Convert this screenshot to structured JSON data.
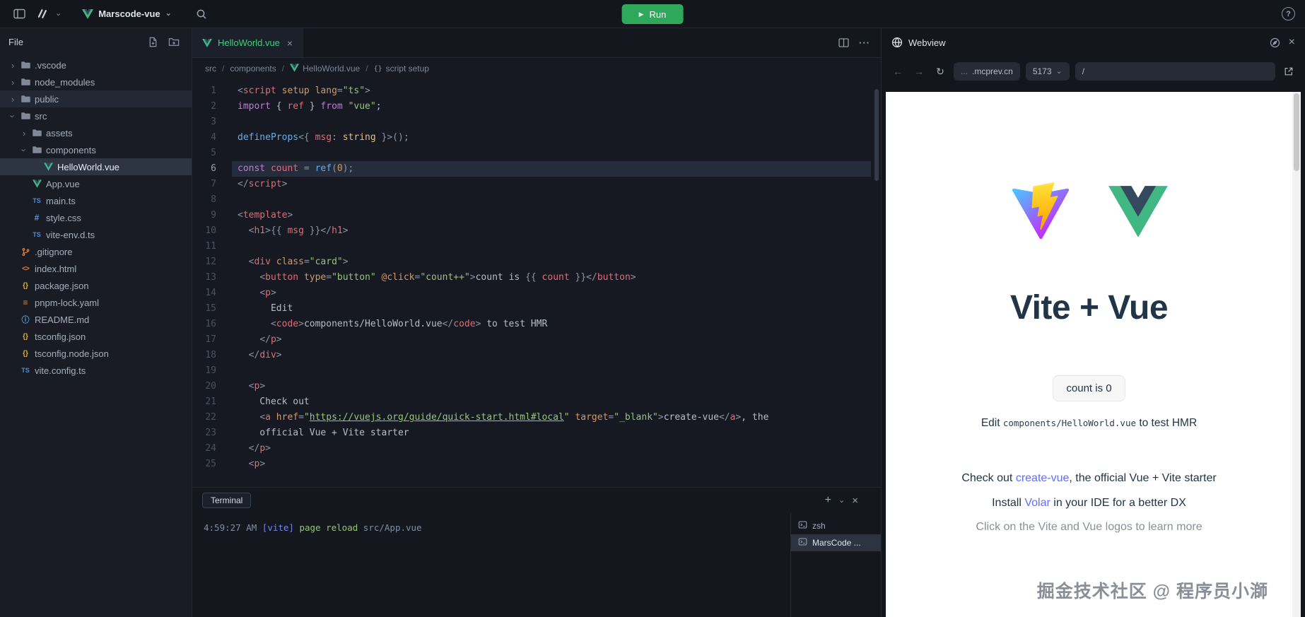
{
  "icons": {
    "chevron_down": "⌄",
    "chevron_right": "›",
    "close": "×",
    "plus": "+",
    "more": "···",
    "play": "▶",
    "help": "?",
    "back": "←",
    "forward": "→",
    "refresh": "↻",
    "crumb_sep": "/",
    "braces": "{}"
  },
  "topbar": {
    "project_name": "Marscode-vue",
    "run_label": "Run"
  },
  "sidebar": {
    "title": "File",
    "tree": [
      {
        "label": ".vscode",
        "type": "folder",
        "level": 0,
        "expanded": false
      },
      {
        "label": "node_modules",
        "type": "folder",
        "level": 0,
        "expanded": false
      },
      {
        "label": "public",
        "type": "folder",
        "level": 0,
        "expanded": false,
        "state": "hover"
      },
      {
        "label": "src",
        "type": "folder",
        "level": 0,
        "expanded": true
      },
      {
        "label": "assets",
        "type": "folder",
        "level": 1,
        "expanded": false
      },
      {
        "label": "components",
        "type": "folder",
        "level": 1,
        "expanded": true
      },
      {
        "label": "HelloWorld.vue",
        "type": "vue",
        "level": 2,
        "state": "selected"
      },
      {
        "label": "App.vue",
        "type": "vue",
        "level": 1
      },
      {
        "label": "main.ts",
        "type": "ts",
        "level": 1
      },
      {
        "label": "style.css",
        "type": "css",
        "level": 1
      },
      {
        "label": "vite-env.d.ts",
        "type": "ts",
        "level": 1
      },
      {
        "label": ".gitignore",
        "type": "git",
        "level": 0
      },
      {
        "label": "index.html",
        "type": "html",
        "level": 0
      },
      {
        "label": "package.json",
        "type": "json",
        "level": 0
      },
      {
        "label": "pnpm-lock.yaml",
        "type": "yaml",
        "level": 0
      },
      {
        "label": "README.md",
        "type": "md",
        "level": 0
      },
      {
        "label": "tsconfig.json",
        "type": "json",
        "level": 0
      },
      {
        "label": "tsconfig.node.json",
        "type": "json",
        "level": 0
      },
      {
        "label": "vite.config.ts",
        "type": "ts",
        "level": 0
      }
    ]
  },
  "editor": {
    "tab_label": "HelloWorld.vue",
    "breadcrumb": [
      {
        "label": "src"
      },
      {
        "label": "components"
      },
      {
        "label": "HelloWorld.vue",
        "icon": "vue"
      },
      {
        "label": "script setup",
        "icon": "braces"
      }
    ],
    "active_line": 6,
    "lines": [
      [
        [
          "pu",
          "<"
        ],
        [
          "tg",
          "script"
        ],
        [
          "pl",
          " "
        ],
        [
          "at",
          "setup"
        ],
        [
          "pl",
          " "
        ],
        [
          "at",
          "lang"
        ],
        [
          "pu",
          "="
        ],
        [
          "st",
          "\"ts\""
        ],
        [
          "pu",
          ">"
        ]
      ],
      [
        [
          "kw",
          "import"
        ],
        [
          "pl",
          " { "
        ],
        [
          "vr",
          "ref"
        ],
        [
          "pl",
          " } "
        ],
        [
          "kw",
          "from"
        ],
        [
          "pl",
          " "
        ],
        [
          "st",
          "\"vue\""
        ],
        [
          "pl",
          ";"
        ]
      ],
      [],
      [
        [
          "fn",
          "defineProps"
        ],
        [
          "pu",
          "<{ "
        ],
        [
          "vr",
          "msg"
        ],
        [
          "pu",
          ": "
        ],
        [
          "ty",
          "string"
        ],
        [
          "pu",
          " }>();"
        ]
      ],
      [],
      [
        [
          "kw",
          "const"
        ],
        [
          "pl",
          " "
        ],
        [
          "vr",
          "count"
        ],
        [
          "pu",
          " = "
        ],
        [
          "fn",
          "ref"
        ],
        [
          "pu",
          "("
        ],
        [
          "nu",
          "0"
        ],
        [
          "pu",
          ");"
        ]
      ],
      [
        [
          "pu",
          "</"
        ],
        [
          "tg",
          "script"
        ],
        [
          "pu",
          ">"
        ]
      ],
      [],
      [
        [
          "pu",
          "<"
        ],
        [
          "tg",
          "template"
        ],
        [
          "pu",
          ">"
        ]
      ],
      [
        [
          "pl",
          "  "
        ],
        [
          "pu",
          "<"
        ],
        [
          "tg",
          "h1"
        ],
        [
          "pu",
          ">"
        ],
        [
          "pu",
          "{{ "
        ],
        [
          "vr",
          "msg"
        ],
        [
          "pu",
          " }}"
        ],
        [
          "pu",
          "</"
        ],
        [
          "tg",
          "h1"
        ],
        [
          "pu",
          ">"
        ]
      ],
      [],
      [
        [
          "pl",
          "  "
        ],
        [
          "pu",
          "<"
        ],
        [
          "tg",
          "div"
        ],
        [
          "pl",
          " "
        ],
        [
          "at",
          "class"
        ],
        [
          "pu",
          "="
        ],
        [
          "st",
          "\"card\""
        ],
        [
          "pu",
          ">"
        ]
      ],
      [
        [
          "pl",
          "    "
        ],
        [
          "pu",
          "<"
        ],
        [
          "tg",
          "button"
        ],
        [
          "pl",
          " "
        ],
        [
          "at",
          "type"
        ],
        [
          "pu",
          "="
        ],
        [
          "st",
          "\"button\""
        ],
        [
          "pl",
          " "
        ],
        [
          "at",
          "@click"
        ],
        [
          "pu",
          "="
        ],
        [
          "st",
          "\"count++\""
        ],
        [
          "pu",
          ">"
        ],
        [
          "pl",
          "count is "
        ],
        [
          "pu",
          "{{ "
        ],
        [
          "vr",
          "count"
        ],
        [
          "pu",
          " }}"
        ],
        [
          "pu",
          "</"
        ],
        [
          "tg",
          "button"
        ],
        [
          "pu",
          ">"
        ]
      ],
      [
        [
          "pl",
          "    "
        ],
        [
          "pu",
          "<"
        ],
        [
          "tg",
          "p"
        ],
        [
          "pu",
          ">"
        ]
      ],
      [
        [
          "pl",
          "      Edit"
        ]
      ],
      [
        [
          "pl",
          "      "
        ],
        [
          "pu",
          "<"
        ],
        [
          "tg",
          "code"
        ],
        [
          "pu",
          ">"
        ],
        [
          "pl",
          "components/HelloWorld.vue"
        ],
        [
          "pu",
          "</"
        ],
        [
          "tg",
          "code"
        ],
        [
          "pu",
          ">"
        ],
        [
          "pl",
          " to test HMR"
        ]
      ],
      [
        [
          "pl",
          "    "
        ],
        [
          "pu",
          "</"
        ],
        [
          "tg",
          "p"
        ],
        [
          "pu",
          ">"
        ]
      ],
      [
        [
          "pl",
          "  "
        ],
        [
          "pu",
          "</"
        ],
        [
          "tg",
          "div"
        ],
        [
          "pu",
          ">"
        ]
      ],
      [],
      [
        [
          "pl",
          "  "
        ],
        [
          "pu",
          "<"
        ],
        [
          "tg",
          "p"
        ],
        [
          "pu",
          ">"
        ]
      ],
      [
        [
          "pl",
          "    Check out"
        ]
      ],
      [
        [
          "pl",
          "    "
        ],
        [
          "pu",
          "<"
        ],
        [
          "tg",
          "a"
        ],
        [
          "pl",
          " "
        ],
        [
          "at",
          "href"
        ],
        [
          "pu",
          "="
        ],
        [
          "st",
          "\""
        ],
        [
          "lk",
          "https://vuejs.org/guide/quick-start.html#local"
        ],
        [
          "st",
          "\""
        ],
        [
          "pl",
          " "
        ],
        [
          "at",
          "target"
        ],
        [
          "pu",
          "="
        ],
        [
          "st",
          "\"_blank\""
        ],
        [
          "pu",
          ">"
        ],
        [
          "pl",
          "create-vue"
        ],
        [
          "pu",
          "</"
        ],
        [
          "tg",
          "a"
        ],
        [
          "pu",
          ">"
        ],
        [
          "pl",
          ", the"
        ]
      ],
      [
        [
          "pl",
          "    official Vue + Vite starter"
        ]
      ],
      [
        [
          "pl",
          "  "
        ],
        [
          "pu",
          "</"
        ],
        [
          "tg",
          "p"
        ],
        [
          "pu",
          ">"
        ]
      ],
      [
        [
          "pl",
          "  "
        ],
        [
          "pu",
          "<"
        ],
        [
          "tg",
          "p"
        ],
        [
          "pu",
          ">"
        ]
      ]
    ]
  },
  "terminal": {
    "title": "Terminal",
    "log_line": [
      {
        "text": "4:59:27 AM ",
        "style": "dim"
      },
      {
        "text": "[vite]",
        "style": "accent"
      },
      {
        "text": " page reload",
        "style": "green"
      },
      {
        "text": " src/App.vue",
        "style": "dim"
      }
    ],
    "sessions": [
      {
        "label": "zsh",
        "selected": false
      },
      {
        "label": "MarsCode ...",
        "selected": true
      }
    ]
  },
  "webview": {
    "title": "Webview",
    "nav": {
      "truncation": "...",
      "host": ".mcprev.cn",
      "port": "5173",
      "path": "/"
    },
    "content": {
      "heading": "Vite + Vue",
      "count_button": "count is 0",
      "edit_pre": "Edit ",
      "edit_code": "components/HelloWorld.vue",
      "edit_post": " to test HMR",
      "line1_pre": "Check out ",
      "line1_link": "create-vue",
      "line1_post": ", the official Vue + Vite starter",
      "line2_pre": "Install ",
      "line2_link": "Volar",
      "line2_post": " in your IDE for a better DX",
      "line3": "Click on the Vite and Vue logos to learn more",
      "watermark": "掘金技术社区 @ 程序员小溮"
    }
  }
}
